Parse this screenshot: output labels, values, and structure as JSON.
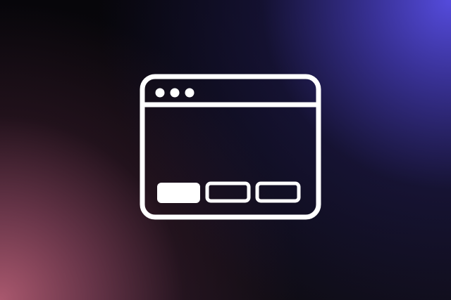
{
  "scene": {
    "type": "browser-window-icon"
  },
  "icons": {
    "primary": "browser-window-icon",
    "window_controls": [
      "window-dot-icon",
      "window-dot-icon",
      "window-dot-icon"
    ],
    "button_group": [
      "filled-button-icon",
      "outline-button-icon",
      "outline-button-icon"
    ]
  },
  "colors": {
    "background": "#0b0a0f",
    "top_right_glow": "#594fe8",
    "bottom_left_glow": "#b25c73",
    "icon_stroke": "#ffffff"
  }
}
